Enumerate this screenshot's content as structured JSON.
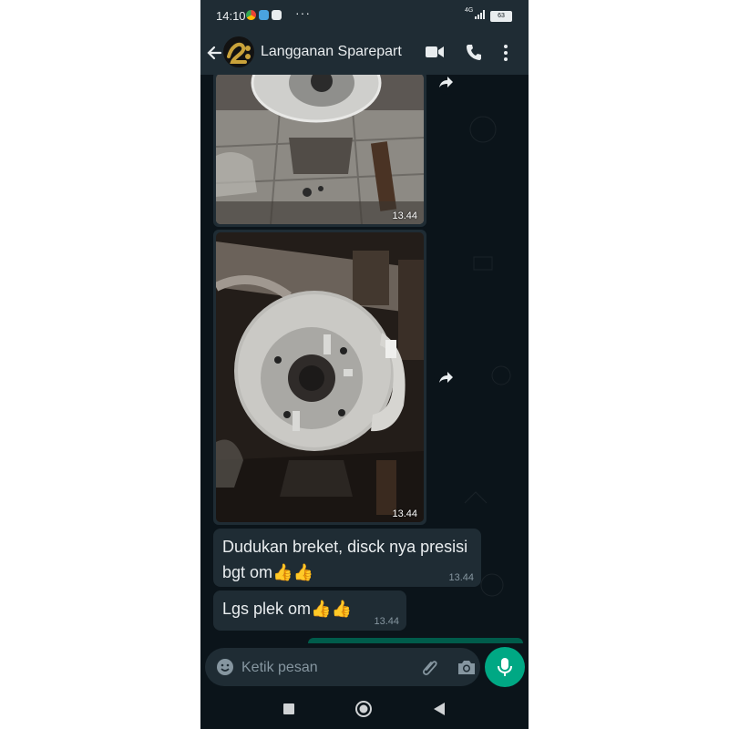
{
  "status_bar": {
    "time": "14:10",
    "more_indicator": "···",
    "network_label": "4G",
    "battery_level": "63"
  },
  "header": {
    "contact_name": "Langganan Sparepart",
    "avatar_text": "2",
    "icons": [
      "back-arrow-icon",
      "video-call-icon",
      "voice-call-icon",
      "more-options-icon"
    ]
  },
  "messages": [
    {
      "type": "image",
      "time": "13.44",
      "description_icon": "forward-icon"
    },
    {
      "type": "image",
      "time": "13.44",
      "description_icon": "forward-icon"
    },
    {
      "type": "text",
      "text": "Dudukan breket, disck nya presisi bgt om👍👍",
      "time": "13.44"
    },
    {
      "type": "text",
      "text": "Lgs plek om👍👍",
      "time": "13.44"
    }
  ],
  "input": {
    "placeholder": "Ketik pesan",
    "value": ""
  },
  "colors": {
    "background": "#0b141a",
    "bar": "#1f2c34",
    "bubble_incoming": "#1f2c34",
    "bubble_outgoing": "#005c4b",
    "accent": "#00a884",
    "text_primary": "#e9edef",
    "text_secondary": "#8696a0"
  }
}
